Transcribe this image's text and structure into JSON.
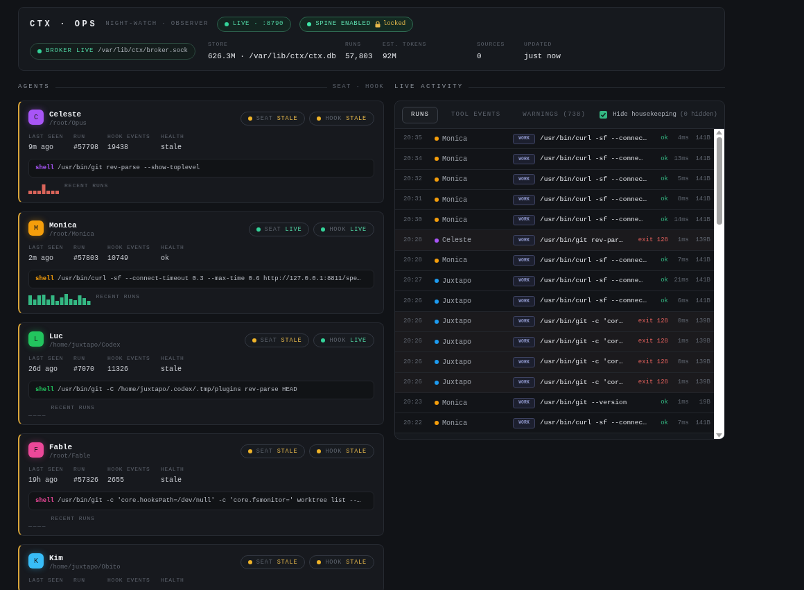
{
  "header": {
    "brand": "CTX · OPS",
    "subtitle": "NIGHT-WATCH · OBSERVER",
    "pills": [
      {
        "kind": "live",
        "text": "LIVE · :8790"
      },
      {
        "kind": "spine",
        "text": "SPINE ENABLED",
        "lock_text": "locked"
      }
    ],
    "broker": {
      "label": "BROKER LIVE",
      "path": "/var/lib/ctx/broker.sock"
    },
    "stats": [
      {
        "label": "STORE",
        "value": "626.3M · /var/lib/ctx/ctx.db"
      },
      {
        "label": "RUNS",
        "value": "57,803"
      },
      {
        "label": "EST. TOKENS",
        "value": "92M"
      },
      {
        "label": "SOURCES",
        "value": "0"
      },
      {
        "label": "UPDATED",
        "value": "just now"
      }
    ]
  },
  "agents_section": {
    "title": "AGENTS",
    "legend": "SEAT · HOOK"
  },
  "agents": [
    {
      "initial": "C",
      "name": "Celeste",
      "path": "/root/Opus",
      "color": "#a855f7",
      "seat": {
        "label": "SEAT",
        "state": "STALE",
        "live": false
      },
      "hook": {
        "label": "HOOK",
        "state": "STALE",
        "live": false
      },
      "stats": [
        {
          "label": "LAST SEEN",
          "value": "9m ago"
        },
        {
          "label": "RUN",
          "value": "#57798"
        },
        {
          "label": "HOOK EVENTS",
          "value": "19438"
        },
        {
          "label": "HEALTH",
          "value": "stale"
        }
      ],
      "command": {
        "prefix": "shell",
        "text": "/usr/bin/git rev-parse --show-toplevel"
      },
      "recent_runs": {
        "label": "RECENT RUNS",
        "kind": "errors"
      }
    },
    {
      "initial": "M",
      "name": "Monica",
      "path": "/root/Monica",
      "color": "#f59e0b",
      "seat": {
        "label": "SEAT",
        "state": "LIVE",
        "live": true
      },
      "hook": {
        "label": "HOOK",
        "state": "LIVE",
        "live": true
      },
      "stats": [
        {
          "label": "LAST SEEN",
          "value": "2m ago"
        },
        {
          "label": "RUN",
          "value": "#57803"
        },
        {
          "label": "HOOK EVENTS",
          "value": "10749"
        },
        {
          "label": "HEALTH",
          "value": "ok"
        }
      ],
      "command": {
        "prefix": "shell",
        "text": "/usr/bin/curl -sf --connect-timeout 0.3 --max-time 0.6 http://127.0.0.1:8811/spe…"
      },
      "recent_runs": {
        "label": "RECENT RUNS",
        "kind": "ok"
      }
    },
    {
      "initial": "L",
      "name": "Luc",
      "path": "/home/juxtapo/Codex",
      "color": "#22c55e",
      "seat": {
        "label": "SEAT",
        "state": "STALE",
        "live": false
      },
      "hook": {
        "label": "HOOK",
        "state": "LIVE",
        "live": true
      },
      "stats": [
        {
          "label": "LAST SEEN",
          "value": "26d ago"
        },
        {
          "label": "RUN",
          "value": "#7070"
        },
        {
          "label": "HOOK EVENTS",
          "value": "11326"
        },
        {
          "label": "HEALTH",
          "value": "stale"
        }
      ],
      "command": {
        "prefix": "shell",
        "text": "/usr/bin/git -C /home/juxtapo/.codex/.tmp/plugins rev-parse HEAD"
      },
      "recent_runs": {
        "label": "RECENT RUNS",
        "kind": "none"
      }
    },
    {
      "initial": "F",
      "name": "Fable",
      "path": "/root/Fable",
      "color": "#ec4899",
      "seat": {
        "label": "SEAT",
        "state": "STALE",
        "live": false
      },
      "hook": {
        "label": "HOOK",
        "state": "STALE",
        "live": false
      },
      "stats": [
        {
          "label": "LAST SEEN",
          "value": "19h ago"
        },
        {
          "label": "RUN",
          "value": "#57326"
        },
        {
          "label": "HOOK EVENTS",
          "value": "2655"
        },
        {
          "label": "HEALTH",
          "value": "stale"
        }
      ],
      "command": {
        "prefix": "shell",
        "text": "/usr/bin/git -c 'core.hooksPath=/dev/null' -c 'core.fsmonitor=' worktree list --…"
      },
      "recent_runs": {
        "label": "RECENT RUNS",
        "kind": "none"
      }
    },
    {
      "initial": "K",
      "name": "Kim",
      "path": "/home/juxtapo/Obito",
      "color": "#38bdf8",
      "seat": {
        "label": "SEAT",
        "state": "STALE",
        "live": false
      },
      "hook": {
        "label": "HOOK",
        "state": "STALE",
        "live": false
      },
      "stats": [
        {
          "label": "LAST SEEN"
        },
        {
          "label": "RUN"
        },
        {
          "label": "HOOK EVENTS"
        },
        {
          "label": "HEALTH"
        }
      ]
    }
  ],
  "activity": {
    "title": "LIVE ACTIVITY",
    "tabs": [
      {
        "label": "RUNS",
        "selected": true
      },
      {
        "label": "TOOL EVENTS",
        "selected": false
      },
      {
        "label": "WARNINGS (738)",
        "selected": false
      }
    ],
    "housekeeping": {
      "checked": true,
      "label": "Hide housekeeping",
      "note": "(0 hidden)"
    },
    "runs": [
      {
        "time": "20:35",
        "agent": "Monica",
        "color": "#f59e0b",
        "tag": "WORK",
        "command": "/usr/bin/curl -sf --connec…",
        "status": "ok",
        "failed": false,
        "duration": "4ms",
        "size": "141B"
      },
      {
        "time": "20:34",
        "agent": "Monica",
        "color": "#f59e0b",
        "tag": "WORK",
        "command": "/usr/bin/curl -sf --conne…",
        "status": "ok",
        "failed": false,
        "duration": "13ms",
        "size": "141B"
      },
      {
        "time": "20:32",
        "agent": "Monica",
        "color": "#f59e0b",
        "tag": "WORK",
        "command": "/usr/bin/curl -sf --connec…",
        "status": "ok",
        "failed": false,
        "duration": "5ms",
        "size": "141B"
      },
      {
        "time": "20:31",
        "agent": "Monica",
        "color": "#f59e0b",
        "tag": "WORK",
        "command": "/usr/bin/curl -sf --connec…",
        "status": "ok",
        "failed": false,
        "duration": "8ms",
        "size": "141B"
      },
      {
        "time": "20:30",
        "agent": "Monica",
        "color": "#f59e0b",
        "tag": "WORK",
        "command": "/usr/bin/curl -sf --conne…",
        "status": "ok",
        "failed": false,
        "duration": "14ms",
        "size": "141B"
      },
      {
        "time": "20:28",
        "agent": "Celeste",
        "color": "#a855f7",
        "tag": "WORK",
        "command": "/usr/bin/git rev-par…",
        "status": "exit 128",
        "failed": true,
        "duration": "1ms",
        "size": "139B"
      },
      {
        "time": "20:28",
        "agent": "Monica",
        "color": "#f59e0b",
        "tag": "WORK",
        "command": "/usr/bin/curl -sf --connec…",
        "status": "ok",
        "failed": false,
        "duration": "7ms",
        "size": "141B"
      },
      {
        "time": "20:27",
        "agent": "Juxtapo",
        "color": "#1d9bf0",
        "tag": "WORK",
        "command": "/usr/bin/curl -sf --conne…",
        "status": "ok",
        "failed": false,
        "duration": "21ms",
        "size": "141B"
      },
      {
        "time": "20:26",
        "agent": "Juxtapo",
        "color": "#1d9bf0",
        "tag": "WORK",
        "command": "/usr/bin/curl -sf --connec…",
        "status": "ok",
        "failed": false,
        "duration": "6ms",
        "size": "141B"
      },
      {
        "time": "20:26",
        "agent": "Juxtapo",
        "color": "#1d9bf0",
        "tag": "WORK",
        "command": "/usr/bin/git -c 'cor…",
        "status": "exit 128",
        "failed": true,
        "duration": "0ms",
        "size": "139B"
      },
      {
        "time": "20:26",
        "agent": "Juxtapo",
        "color": "#1d9bf0",
        "tag": "WORK",
        "command": "/usr/bin/git -c 'cor…",
        "status": "exit 128",
        "failed": true,
        "duration": "1ms",
        "size": "139B"
      },
      {
        "time": "20:26",
        "agent": "Juxtapo",
        "color": "#1d9bf0",
        "tag": "WORK",
        "command": "/usr/bin/git -c 'cor…",
        "status": "exit 128",
        "failed": true,
        "duration": "0ms",
        "size": "139B"
      },
      {
        "time": "20:26",
        "agent": "Juxtapo",
        "color": "#1d9bf0",
        "tag": "WORK",
        "command": "/usr/bin/git -c 'cor…",
        "status": "exit 128",
        "failed": true,
        "duration": "1ms",
        "size": "139B"
      },
      {
        "time": "20:23",
        "agent": "Monica",
        "color": "#f59e0b",
        "tag": "WORK",
        "command": "/usr/bin/git --version",
        "status": "ok",
        "failed": false,
        "duration": "1ms",
        "size": "19B"
      },
      {
        "time": "20:22",
        "agent": "Monica",
        "color": "#f59e0b",
        "tag": "WORK",
        "command": "/usr/bin/curl -sf --connec…",
        "status": "ok",
        "failed": false,
        "duration": "7ms",
        "size": "141B"
      }
    ]
  }
}
